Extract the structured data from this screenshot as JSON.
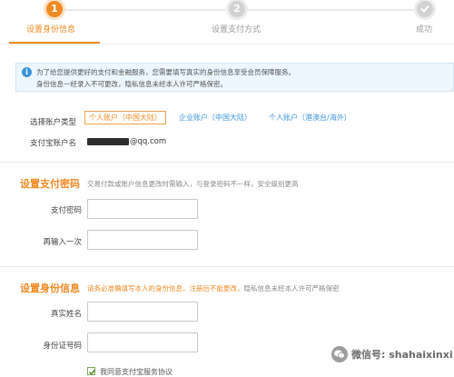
{
  "steps": [
    {
      "number": "1",
      "label": "设置身份信息",
      "state": "active"
    },
    {
      "number": "2",
      "label": "设置支付方式",
      "state": "pending"
    },
    {
      "number": "",
      "label": "成功",
      "state": "pending"
    }
  ],
  "notice": {
    "icon": "info-icon",
    "line1": "为了给您提供更好的支付和金融服务，您需要填写真实的身份信息享受会员保障服务。",
    "line2": "身份信息一经录入不可更改，隐私信息未经本人许可严格保密。"
  },
  "account_type": {
    "label": "选择账户类型",
    "options": [
      {
        "label": "个人账户（中国大陆）",
        "selected": true
      },
      {
        "label": "企业账户（中国大陆）",
        "selected": false
      },
      {
        "label": "个人账户（港澳台/海外）",
        "selected": false
      }
    ]
  },
  "alipay_account": {
    "label": "支付宝账户名",
    "value": "@qq.com"
  },
  "payment_password": {
    "title": "设置支付密码",
    "description": "交易付款或账户信息更改时需输入，与登录密码不一样，安全级别更高",
    "fields": [
      {
        "label": "支付密码",
        "value": ""
      },
      {
        "label": "再输入一次",
        "value": ""
      }
    ]
  },
  "identity": {
    "title": "设置身份信息",
    "description_warning": "请务必准确填写本人的身份信息，注册后不能更改，",
    "description_rest": "隐私信息未经本人许可严格保密",
    "fields": [
      {
        "label": "真实姓名",
        "value": ""
      },
      {
        "label": "身份证号码",
        "value": ""
      }
    ]
  },
  "agreement": {
    "checked": true,
    "text": "我同意支付宝服务协议"
  },
  "watermark": {
    "icon": "wechat-icon",
    "text": "微信号: shahaixinxi"
  },
  "colors": {
    "accent": "#f08a24",
    "link": "#3b93de",
    "notice_bg": "#edf6fd"
  }
}
